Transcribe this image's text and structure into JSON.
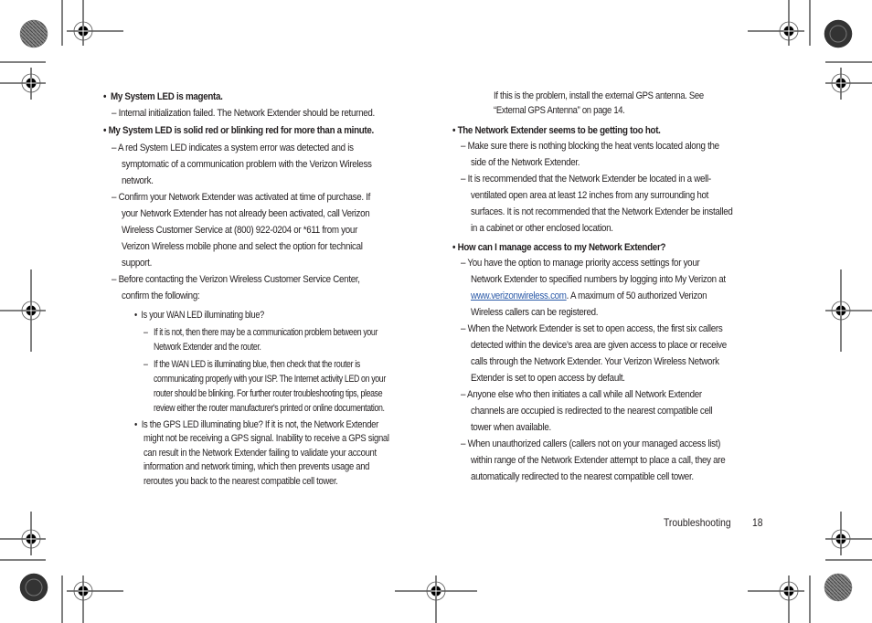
{
  "left_column": {
    "q1": {
      "bullet": "•",
      "heading": "My System LED is magenta.",
      "answers": [
        "– Internal initialization failed. The Network Extender  should be returned."
      ]
    },
    "q2": {
      "bullet": "•",
      "heading": "My System LED is solid red or blinking red for more than a minute.",
      "a1_lines": [
        "– A red System LED indicates a system error was detected and is",
        "symptomatic of a communication problem with the Verizon Wireless",
        "network."
      ],
      "a2_lines": [
        "– Confirm your Network Extender was activated at time of purchase. If",
        "your Network Extender has not already been activated, call Verizon",
        "Wireless Customer Service at (800) 922-0204 or *611 from your",
        "Verizon Wireless mobile phone and select the option for technical",
        "support."
      ],
      "a3_lines": [
        "– Before contacting the Verizon Wireless Customer Service Center,",
        "confirm the following:"
      ],
      "checks": {
        "wan": {
          "bullet": "•",
          "question": "Is your WAN LED illuminating blue?",
          "sub1_lines": [
            "–",
            "If it is not, then there may be a communication problem between your",
            "Network Extender and the router."
          ],
          "sub2_lines": [
            "–",
            "If the WAN LED is illuminating blue, then check that the router is",
            "communicating properly with your ISP. The Internet activity LED on your",
            "router should be blinking. For further router troubleshooting tips, please",
            "review either the router manufacturer's printed or online documentation."
          ]
        },
        "gps": {
          "bullet": "•",
          "lines": [
            "Is the GPS LED illuminating blue? If it is not, the Network Extender",
            "might not be receiving a GPS signal. Inability to receive a GPS signal",
            "can result in the Network Extender failing to validate your account",
            "information and network timing, which then prevents usage and",
            "reroutes you back to the nearest compatible cell tower."
          ]
        }
      }
    }
  },
  "right_column": {
    "gps_cont_lines": [
      "If this is the problem, install the external GPS antenna. See",
      "“External GPS Antenna” on page 14."
    ],
    "q3": {
      "bullet": "•",
      "heading": "The Network Extender seems to be getting too hot.",
      "a1_lines": [
        "– Make sure there is nothing blocking the heat vents located along the",
        "side of the Network Extender."
      ],
      "a2_lines": [
        "– It is recommended that the Network Extender be located in a well-",
        "ventilated open area at least 12 inches from any surrounding hot",
        "surfaces. It is not recommended that the Network Extender be installed",
        "in a cabinet or other enclosed location."
      ]
    },
    "q4": {
      "bullet": "•",
      "heading": "How can I manage access to my Network Extender?",
      "a1_lines": [
        "– You have the option to manage priority access settings for your",
        "Network Extender to specified numbers by logging into My Verizon at"
      ],
      "a1_link": "www.verizonwireless.com",
      "a1_after_link": ". A maximum of 50 authorized Verizon",
      "a1_last": "Wireless callers can be registered.",
      "a2_lines": [
        "– When the Network Extender is set to open access, the first six callers",
        "detected within the device’s area are given access to place or receive",
        "calls through the Network Extender. Your Verizon Wireless Network",
        "Extender is set to open access by default."
      ],
      "a3_lines": [
        "– Anyone else who then initiates a call while all Network Extender",
        "channels are occupied is redirected to the nearest compatible cell",
        "tower when available."
      ],
      "a4_lines": [
        "– When unauthorized callers (callers not on your managed access list)",
        "within range of the Network Extender attempt to place a call, they are",
        "automatically redirected to the nearest compatible cell tower."
      ]
    }
  },
  "footer": {
    "section": "Troubleshooting",
    "page_number": "18"
  },
  "colors": {
    "text": "#231f20",
    "link": "#2b5aa8"
  }
}
